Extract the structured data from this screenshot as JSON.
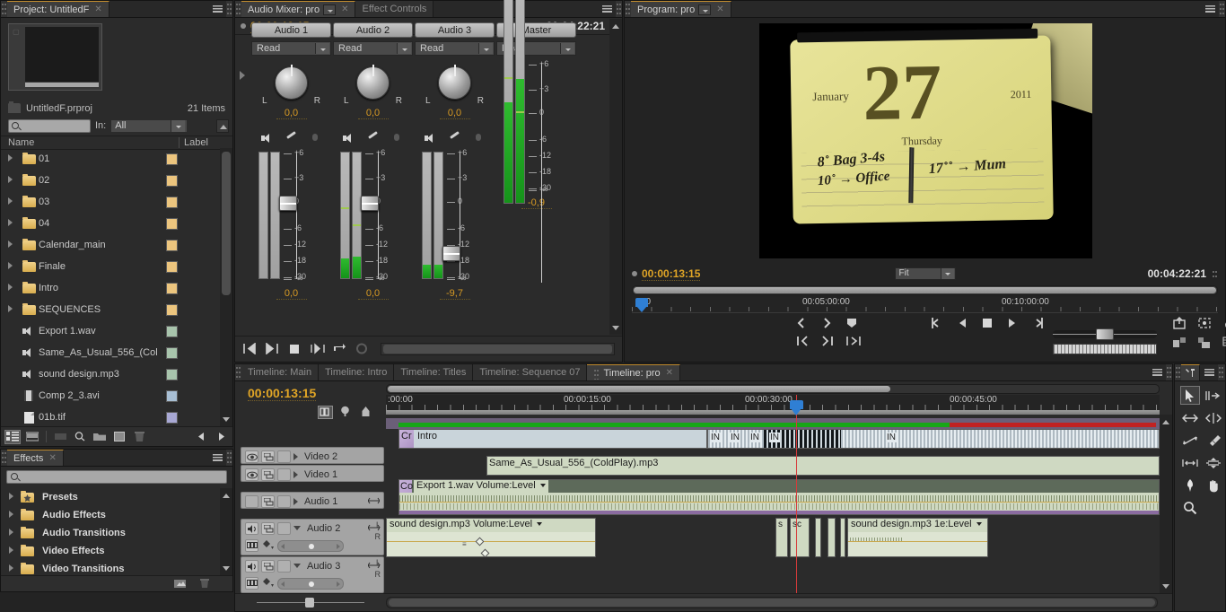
{
  "project_panel": {
    "tab_label": "Project: UntitledF",
    "file_name": "UntitledF.prproj",
    "item_count": "21 Items",
    "search_placeholder": "",
    "filter_label": "In:",
    "filter_value": "All",
    "columns": {
      "name": "Name",
      "label": "Label"
    },
    "items": [
      {
        "name": "01",
        "type": "folder",
        "color": "#ecc57e",
        "expandable": true
      },
      {
        "name": "02",
        "type": "folder",
        "color": "#ecc57e",
        "expandable": true
      },
      {
        "name": "03",
        "type": "folder",
        "color": "#ecc57e",
        "expandable": true
      },
      {
        "name": "04",
        "type": "folder",
        "color": "#ecc57e",
        "expandable": true
      },
      {
        "name": "Calendar_main",
        "type": "folder",
        "color": "#ecc57e",
        "expandable": true
      },
      {
        "name": "Finale",
        "type": "folder",
        "color": "#ecc57e",
        "expandable": true
      },
      {
        "name": "Intro",
        "type": "folder",
        "color": "#ecc57e",
        "expandable": true
      },
      {
        "name": "SEQUENCES",
        "type": "folder",
        "color": "#ecc57e",
        "expandable": true
      },
      {
        "name": "Export 1.wav",
        "type": "audio",
        "color": "#a8c4ac",
        "expandable": false
      },
      {
        "name": "Same_As_Usual_556_(Col",
        "type": "audio",
        "color": "#a8c4ac",
        "expandable": false
      },
      {
        "name": "sound design.mp3",
        "type": "audio",
        "color": "#a8c4ac",
        "expandable": false
      },
      {
        "name": "Comp 2_3.avi",
        "type": "video",
        "color": "#a8bfd4",
        "expandable": false
      },
      {
        "name": "01b.tif",
        "type": "image",
        "color": "#a8a8d4",
        "expandable": false
      }
    ]
  },
  "mixer_panel": {
    "tabs": [
      {
        "label": "Audio Mixer: pro",
        "active": true,
        "closable": true,
        "has_dropdown": true
      },
      {
        "label": "Effect Controls",
        "active": false,
        "closable": false,
        "has_dropdown": false
      }
    ],
    "current_timecode": "00:00:13:15",
    "duration_timecode": "00:04:22:21",
    "channels": [
      {
        "name": "Audio 1",
        "automation_mode": "Read",
        "pan": "0,0",
        "gain": "0,0",
        "fader_db": 0,
        "meter_l": 0,
        "meter_r": 0,
        "peak_l": null,
        "peak_r": null
      },
      {
        "name": "Audio 2",
        "automation_mode": "Read",
        "pan": "0,0",
        "gain": "0,0",
        "fader_db": 0,
        "meter_l": 16,
        "meter_r": 17,
        "peak_l": -7,
        "peak_r": -17
      },
      {
        "name": "Audio 3",
        "automation_mode": "Read",
        "pan": "0,0",
        "gain": "-9,7",
        "fader_db": -10,
        "meter_l": 11,
        "meter_r": 11,
        "peak_l": null,
        "peak_r": null
      },
      {
        "name": "Master",
        "automation_mode": "Read",
        "pan": null,
        "gain": "-0,9",
        "fader_db": -1,
        "meter_l": 46,
        "meter_r": 57,
        "peak_l": -6,
        "peak_r": -17
      }
    ],
    "scale_labels": [
      "+6",
      "+3",
      "0",
      "-6",
      "-12",
      "-18",
      "-30",
      "-∞"
    ],
    "pan_left": "L",
    "pan_right": "R"
  },
  "program_panel": {
    "tab_label": "Program: pro",
    "current_timecode": "00:00:13:15",
    "duration_timecode": "00:04:22:21",
    "zoom_level": "Fit",
    "ruler_labels": [
      "00",
      "00:05:00:00",
      "00:10:00:00"
    ],
    "video_frame": {
      "month": "January",
      "day_number": "27",
      "year": "2011",
      "weekday": "Thursday",
      "handwriting_1": "8˚ Bag 3-4s",
      "handwriting_2": "10˚ → Office",
      "handwriting_3": "17˚˚ → Mum"
    }
  },
  "effects_panel": {
    "tab_label": "Effects",
    "search_placeholder": "",
    "items": [
      {
        "name": "Presets",
        "icon": "star-folder-icon"
      },
      {
        "name": "Audio Effects",
        "icon": "folder-icon"
      },
      {
        "name": "Audio Transitions",
        "icon": "folder-icon"
      },
      {
        "name": "Video Effects",
        "icon": "folder-icon"
      },
      {
        "name": "Video Transitions",
        "icon": "folder-icon"
      }
    ]
  },
  "timeline_panel": {
    "tabs": [
      {
        "label": "Timeline: Main",
        "active": false
      },
      {
        "label": "Timeline: Intro",
        "active": false
      },
      {
        "label": "Timeline: Titles",
        "active": false
      },
      {
        "label": "Timeline: Sequence 07",
        "active": false
      },
      {
        "label": "Timeline: pro",
        "active": true
      }
    ],
    "current_timecode": "00:00:13:15",
    "ruler_labels": [
      ":00:00",
      "00:00:15:00",
      "00:00:30:00",
      "00:00:45:00"
    ],
    "tracks": [
      {
        "name": "Video 2",
        "type": "video",
        "collapsed": true,
        "eye": true,
        "lock": false
      },
      {
        "name": "Video 1",
        "type": "video",
        "collapsed": true,
        "eye": true,
        "lock": false
      },
      {
        "name": "Audio 1",
        "type": "audio",
        "collapsed": true,
        "speaker": false
      },
      {
        "name": "Audio 2",
        "type": "audio",
        "collapsed": false,
        "speaker": true,
        "channel_l": "L",
        "channel_r": "R"
      },
      {
        "name": "Audio 3",
        "type": "audio",
        "collapsed": false,
        "speaker": true,
        "channel_l": "L",
        "channel_r": "R"
      }
    ],
    "clips": [
      {
        "track": "Video 1",
        "label": "Intro",
        "transition_label": "Cr"
      },
      {
        "track": "Video 1",
        "label": "IN",
        "repeats": 5
      },
      {
        "track": "Audio 1",
        "label": "Same_As_Usual_556_(ColdPlay).mp3"
      },
      {
        "track": "Audio 2",
        "label": "Export 1.wav",
        "effect": "Volume:Level",
        "transition_label": "Co"
      },
      {
        "track": "Audio 3",
        "label": "sound design.mp3",
        "effect": "Volume:Level"
      },
      {
        "track": "Audio 3",
        "label": "s",
        "short": true
      },
      {
        "track": "Audio 3",
        "label": "sc",
        "short": true
      },
      {
        "track": "Audio 3",
        "label": "sound design.mp3",
        "effect": "1e:Level"
      }
    ]
  },
  "tools_panel": {
    "tools": [
      {
        "name": "selection-tool",
        "selected": true
      },
      {
        "name": "track-select-tool",
        "selected": false
      },
      {
        "name": "ripple-edit-tool",
        "selected": false
      },
      {
        "name": "rolling-edit-tool",
        "selected": false
      },
      {
        "name": "rate-stretch-tool",
        "selected": false
      },
      {
        "name": "razor-tool",
        "selected": false
      },
      {
        "name": "slip-tool",
        "selected": false
      },
      {
        "name": "slide-tool",
        "selected": false
      },
      {
        "name": "pen-tool",
        "selected": false
      },
      {
        "name": "hand-tool",
        "selected": false
      },
      {
        "name": "zoom-tool",
        "selected": false
      }
    ]
  },
  "colors": {
    "panel_bg": "#2b2b2b",
    "accent_yellow": "#e0a526",
    "active_tab_border": "#c08b2e",
    "playhead_red": "#d63b3b",
    "render_green": "#17a617",
    "render_red": "#c02222",
    "meter_green": "#2fbb2f"
  }
}
